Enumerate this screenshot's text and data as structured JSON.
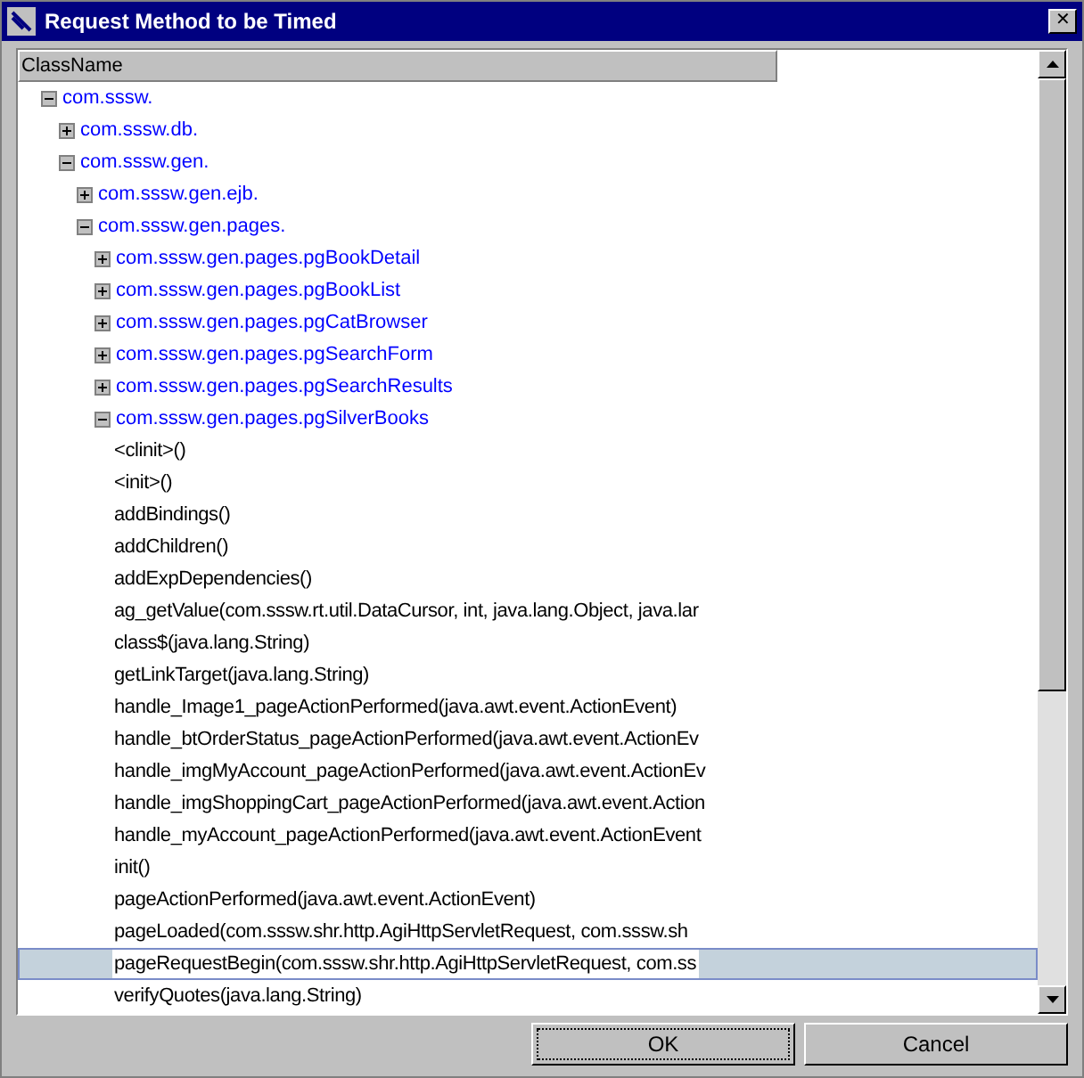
{
  "window": {
    "title": "Request Method to be Timed",
    "close": "✕"
  },
  "table": {
    "columns": [
      "ClassName"
    ]
  },
  "tree": [
    {
      "kind": "package",
      "label": "com.sssw.",
      "expanded": true,
      "selected": false,
      "children": [
        {
          "kind": "package",
          "label": "com.sssw.db.",
          "expanded": false,
          "selected": false
        },
        {
          "kind": "package",
          "label": "com.sssw.gen.",
          "expanded": true,
          "selected": false,
          "children": [
            {
              "kind": "package",
              "label": "com.sssw.gen.ejb.",
              "expanded": false,
              "selected": false
            },
            {
              "kind": "package",
              "label": "com.sssw.gen.pages.",
              "expanded": true,
              "selected": false,
              "children": [
                {
                  "kind": "package",
                  "label": "com.sssw.gen.pages.pgBookDetail",
                  "expanded": false,
                  "selected": false
                },
                {
                  "kind": "package",
                  "label": "com.sssw.gen.pages.pgBookList",
                  "expanded": false,
                  "selected": false
                },
                {
                  "kind": "package",
                  "label": "com.sssw.gen.pages.pgCatBrowser",
                  "expanded": false,
                  "selected": false
                },
                {
                  "kind": "package",
                  "label": "com.sssw.gen.pages.pgSearchForm",
                  "expanded": false,
                  "selected": false
                },
                {
                  "kind": "package",
                  "label": "com.sssw.gen.pages.pgSearchResults",
                  "expanded": false,
                  "selected": false
                },
                {
                  "kind": "package",
                  "label": "com.sssw.gen.pages.pgSilverBooks",
                  "expanded": true,
                  "selected": false,
                  "children": [
                    {
                      "kind": "method",
                      "label": "<clinit>()",
                      "selected": false
                    },
                    {
                      "kind": "method",
                      "label": "<init>()",
                      "selected": false
                    },
                    {
                      "kind": "method",
                      "label": "addBindings()",
                      "selected": false
                    },
                    {
                      "kind": "method",
                      "label": "addChildren()",
                      "selected": false
                    },
                    {
                      "kind": "method",
                      "label": "addExpDependencies()",
                      "selected": false
                    },
                    {
                      "kind": "method",
                      "label": "ag_getValue(com.sssw.rt.util.DataCursor, int, java.lang.Object, java.lar",
                      "selected": false
                    },
                    {
                      "kind": "method",
                      "label": "class$(java.lang.String)",
                      "selected": false
                    },
                    {
                      "kind": "method",
                      "label": "getLinkTarget(java.lang.String)",
                      "selected": false
                    },
                    {
                      "kind": "method",
                      "label": "handle_Image1_pageActionPerformed(java.awt.event.ActionEvent)",
                      "selected": false
                    },
                    {
                      "kind": "method",
                      "label": "handle_btOrderStatus_pageActionPerformed(java.awt.event.ActionEv",
                      "selected": false
                    },
                    {
                      "kind": "method",
                      "label": "handle_imgMyAccount_pageActionPerformed(java.awt.event.ActionEv",
                      "selected": false
                    },
                    {
                      "kind": "method",
                      "label": "handle_imgShoppingCart_pageActionPerformed(java.awt.event.Action",
                      "selected": false
                    },
                    {
                      "kind": "method",
                      "label": "handle_myAccount_pageActionPerformed(java.awt.event.ActionEvent",
                      "selected": false
                    },
                    {
                      "kind": "method",
                      "label": "init()",
                      "selected": false
                    },
                    {
                      "kind": "method",
                      "label": "pageActionPerformed(java.awt.event.ActionEvent)",
                      "selected": false
                    },
                    {
                      "kind": "method",
                      "label": "pageLoaded(com.sssw.shr.http.AgiHttpServletRequest, com.sssw.sh",
                      "selected": false
                    },
                    {
                      "kind": "method",
                      "label": "pageRequestBegin(com.sssw.shr.http.AgiHttpServletRequest, com.ss",
                      "selected": true
                    },
                    {
                      "kind": "method",
                      "label": "verifyQuotes(java.lang.String)",
                      "selected": false
                    }
                  ]
                }
              ]
            }
          ]
        }
      ]
    }
  ],
  "buttons": [
    {
      "label": "OK",
      "default": true
    },
    {
      "label": "Cancel",
      "default": false
    }
  ]
}
